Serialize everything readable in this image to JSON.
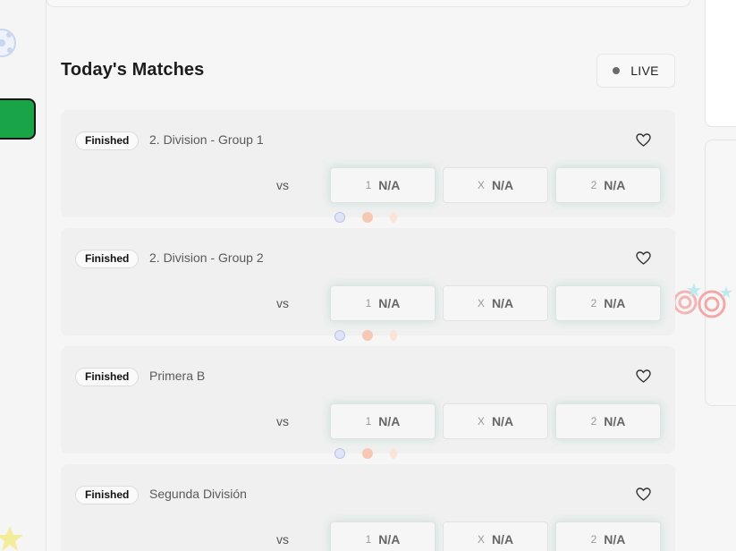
{
  "header": {
    "title": "Today's Matches",
    "live_label": "LIVE"
  },
  "matches": [
    {
      "status": "Finished",
      "league": "2. Division - Group 1",
      "vs": "vs",
      "odds": [
        {
          "key": "1",
          "value": "N/A"
        },
        {
          "key": "X",
          "value": "N/A"
        },
        {
          "key": "2",
          "value": "N/A"
        }
      ]
    },
    {
      "status": "Finished",
      "league": "2. Division - Group 2",
      "vs": "vs",
      "odds": [
        {
          "key": "1",
          "value": "N/A"
        },
        {
          "key": "X",
          "value": "N/A"
        },
        {
          "key": "2",
          "value": "N/A"
        }
      ]
    },
    {
      "status": "Finished",
      "league": "Primera B",
      "vs": "vs",
      "odds": [
        {
          "key": "1",
          "value": "N/A"
        },
        {
          "key": "X",
          "value": "N/A"
        },
        {
          "key": "2",
          "value": "N/A"
        }
      ]
    },
    {
      "status": "Finished",
      "league": "Segunda División",
      "vs": "vs",
      "odds": [
        {
          "key": "1",
          "value": "N/A"
        },
        {
          "key": "X",
          "value": "N/A"
        },
        {
          "key": "2",
          "value": "N/A"
        }
      ]
    }
  ],
  "colors": {
    "accent_green": "#19a448",
    "card_bg": "#f0f0f0",
    "live_dot": "#6b6b6b"
  },
  "icons": [
    "soccer-ball-icon",
    "heart-icon",
    "star-icon",
    "target-icon",
    "basketball-icon",
    "tennis-racket-icon"
  ]
}
